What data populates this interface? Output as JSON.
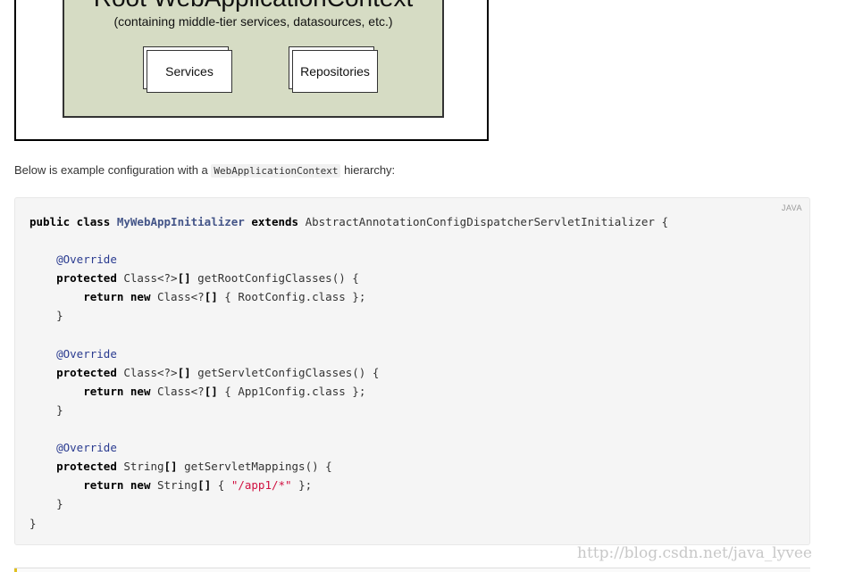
{
  "diagram": {
    "context_title": "Root WebApplicationContext",
    "context_subtitle": "(containing middle-tier services, datasources, etc.)",
    "box_services": "Services",
    "box_repositories": "Repositories"
  },
  "intro": {
    "before": "Below is example configuration with a ",
    "code": "WebApplicationContext",
    "after": " hierarchy:"
  },
  "code_block": {
    "language": "JAVA",
    "class_name": "MyWebAppInitializer",
    "superclass": "AbstractAnnotationConfigDispatcherServletInitializer",
    "annotation": "@Override",
    "method1": "getRootConfigClasses",
    "config1": "RootConfig",
    "method2": "getServletConfigClasses",
    "config2": "App1Config",
    "method3": "getServletMappings",
    "mapping": "\"/app1/*\""
  },
  "watermark": "http://blog.csdn.net/java_lyvee"
}
